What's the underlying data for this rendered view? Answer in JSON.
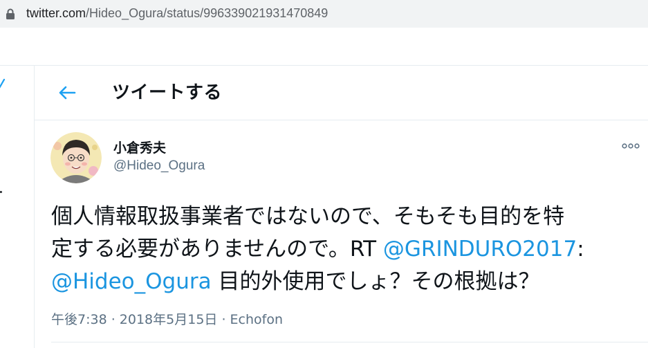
{
  "browser": {
    "url_host": "twitter.com",
    "url_path": "/Hideo_Ogura/status/996339021931470849"
  },
  "header": {
    "title": "ツイートする",
    "back_icon": "arrow-left-icon"
  },
  "tweet": {
    "author_name": "小倉秀夫",
    "author_handle": "@Hideo_Ogura",
    "line1": "個人情報取扱事業者ではないので、そもそも目的を特",
    "line2_text": "定する必要がありませんので。RT ",
    "line2_mention": "@GRINDURO2017",
    "line2_colon": ":",
    "line3_mention": "@Hideo_Ogura",
    "line3_text": " 目的外使用でしょ？その根拠は？",
    "time": "午後7:38",
    "sep1": " · ",
    "date": "2018年5月15日",
    "sep2": " · ",
    "source": "Echofon",
    "more_icon": "more-horizontal-icon"
  },
  "colors": {
    "accent": "#1da1f2",
    "link": "#1b95e0",
    "secondary_text": "#5b7083",
    "border": "#e6ecf0"
  }
}
